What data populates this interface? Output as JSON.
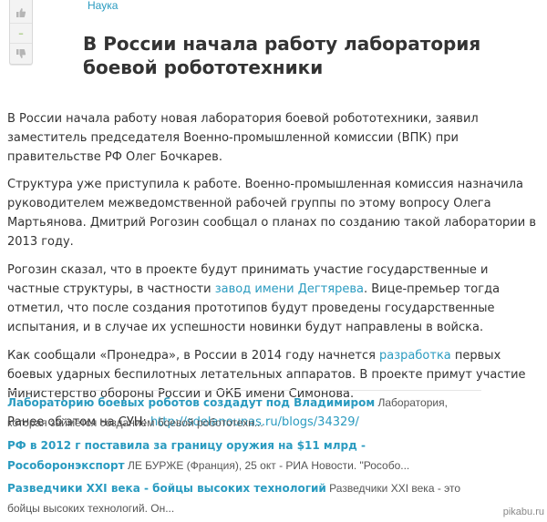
{
  "vote": {
    "rating": "–",
    "up_icon": "thumb-up-icon",
    "down_icon": "thumb-down-icon"
  },
  "post": {
    "category": "Наука",
    "title": "В России начала работу лаборатория боевой робототехники",
    "paragraphs": {
      "p1": "В России начала работу новая лаборатория боевой робототехники, заявил заместитель председателя Военно-промышленной комиссии (ВПК) при правительстве РФ Олег Бочкарев.",
      "p2": "Структура уже приступила к работе. Военно-промышленная комиссия назначила руководителем межведомственной рабочей группы по этому вопросу Олега Мартьянова. Дмитрий Рогозин сообщал о планах по созданию такой лаборатории в 2013 году.",
      "p3_before": "Рогозин сказал, что в проекте будут принимать участие государственные и частные структуры, в частности ",
      "p3_link": "завод имени Дегтярева",
      "p3_after": ". Вице-премьер тогда отметил, что после создания прототипов будут проведены государственные испытания, и в случае их успешности новинки будут направлены в войска.",
      "p4_before": "Как сообщали «Пронедра», в России в 2014 году начнется ",
      "p4_link": "разработка",
      "p4_after": " первых боевых ударных беспилотных летательных аппаратов. В проекте примут участие Министерство обороны России и ОКБ имени Симонова.",
      "p5_before": "Ранее об этом на СУН: ",
      "p5_link": "http://sdelanounas.ru/blogs/34329/"
    }
  },
  "related": [
    {
      "title": "Лабораторию боевых роботов создадут под Владимиром",
      "snippet": " Лаборатория, которая займется созданием боевой робототехн..."
    },
    {
      "title": "РФ в 2012 г поставила за границу оружия на $11 млрд - Рособоронэкспорт",
      "snippet": " ЛЕ БУРЖЕ (Франция), 25 окт - РИА Новости. \"Рособо..."
    },
    {
      "title": "Разведчики XXI века - бойцы высоких технологий",
      "snippet": " Разведчики XXI века - это бойцы высоких технологий. Он..."
    }
  ],
  "watermark": "pikabu.ru"
}
